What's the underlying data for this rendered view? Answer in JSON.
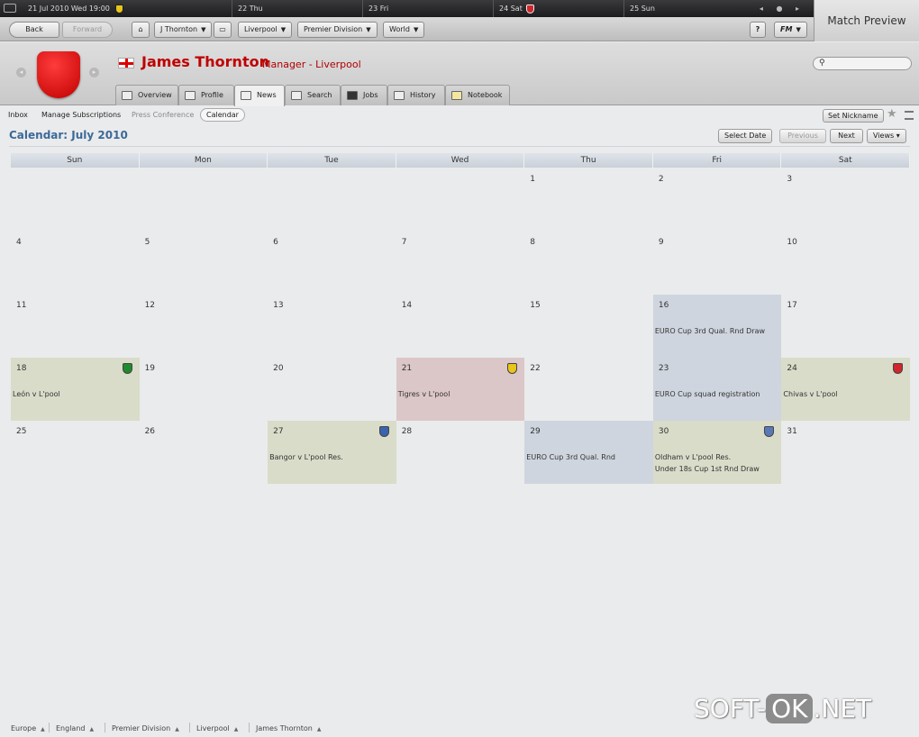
{
  "timeline": {
    "current": "21 Jul 2010",
    "current_day": "Wed 19:00",
    "days": [
      "22 Thu",
      "23 Fri",
      "24 Sat",
      "25 Sun"
    ],
    "controls": "◂ ● ▸"
  },
  "match_preview": "Match Preview",
  "toolbar": {
    "back": "Back",
    "forward": "Forward",
    "manager_menu": "J Thornton",
    "club_menu": "Liverpool",
    "division_menu": "Premier Division",
    "world_menu": "World",
    "help": "?",
    "fm_menu": "FM"
  },
  "header": {
    "name": "James Thornton",
    "role": "Manager - Liverpool",
    "tabs": [
      "Overview",
      "Profile",
      "News",
      "Search",
      "Jobs",
      "History",
      "Notebook"
    ],
    "active_tab": "News"
  },
  "subnav": {
    "items": [
      "Inbox",
      "Manage Subscriptions",
      "Press Conference",
      "Calendar"
    ],
    "set_nickname": "Set Nickname"
  },
  "calendar": {
    "title": "Calendar: July 2010",
    "buttons": {
      "select_date": "Select Date",
      "previous": "Previous",
      "next": "Next",
      "views": "Views"
    },
    "weekdays": [
      "Sun",
      "Mon",
      "Tue",
      "Wed",
      "Thu",
      "Fri",
      "Sat"
    ],
    "weeks": [
      [
        null,
        null,
        null,
        null,
        {
          "day": "1"
        },
        {
          "day": "2"
        },
        {
          "day": "3"
        }
      ],
      [
        {
          "day": "4"
        },
        {
          "day": "5"
        },
        {
          "day": "6"
        },
        {
          "day": "7"
        },
        {
          "day": "8"
        },
        {
          "day": "9"
        },
        {
          "day": "10"
        }
      ],
      [
        {
          "day": "11"
        },
        {
          "day": "12"
        },
        {
          "day": "13"
        },
        {
          "day": "14"
        },
        {
          "day": "15"
        },
        {
          "day": "16",
          "style": "blue",
          "events": [
            "EURO Cup 3rd Qual. Rnd Draw"
          ]
        },
        {
          "day": "17"
        }
      ],
      [
        {
          "day": "18",
          "style": "green",
          "events": [
            "León v L'pool"
          ],
          "badge": "#1f8a2e"
        },
        {
          "day": "19"
        },
        {
          "day": "20"
        },
        {
          "day": "21",
          "style": "pink",
          "events": [
            "Tigres v L'pool"
          ],
          "badge": "#e8c51a"
        },
        {
          "day": "22"
        },
        {
          "day": "23",
          "style": "blue",
          "events": [
            "EURO Cup squad registration"
          ]
        },
        {
          "day": "24",
          "style": "green",
          "events": [
            "Chivas v L'pool"
          ],
          "badge": "#d0262c"
        }
      ],
      [
        {
          "day": "25"
        },
        {
          "day": "26"
        },
        {
          "day": "27",
          "style": "green",
          "events": [
            "Bangor v L'pool Res."
          ],
          "badge": "#3a62b0"
        },
        {
          "day": "28"
        },
        {
          "day": "29",
          "style": "blue",
          "events": [
            "EURO Cup 3rd Qual. Rnd"
          ]
        },
        {
          "day": "30",
          "style": "green",
          "events": [
            "Oldham v L'pool Res.",
            "Under 18s Cup 1st Rnd Draw"
          ],
          "badge": "#5a78b8"
        },
        {
          "day": "31"
        }
      ]
    ]
  },
  "footer": {
    "crumbs": [
      "Europe",
      "England",
      "Premier Division",
      "Liverpool",
      "James Thornton"
    ]
  },
  "watermark": {
    "left": "SOFT-",
    "mid": "OK",
    "right": ".NET"
  },
  "colors": {
    "club_red": "#c00000",
    "title_blue": "#3b6a99"
  }
}
